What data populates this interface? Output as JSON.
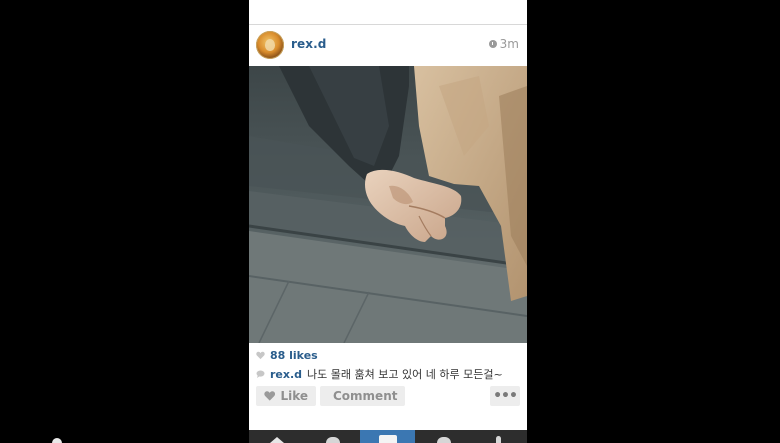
{
  "post": {
    "username": "rex.d",
    "time_ago": "3m",
    "likes": "88 likes",
    "caption_user": "rex.d",
    "caption_text": "나도 몰래 훔쳐 보고 있어 네 하루 모든걸~"
  },
  "actions": {
    "like_label": "Like",
    "comment_label": "Comment",
    "more_label": "•••"
  },
  "icons": {
    "clock": "clock-icon",
    "heart": "heart-icon",
    "comment": "comment-icon",
    "more": "more-icon"
  },
  "nav": {
    "items": [
      "home-icon",
      "explore-icon",
      "camera-icon",
      "news-icon",
      "profile-icon"
    ],
    "active_index": 2
  },
  "colors": {
    "link_blue": "#2a5d8c",
    "nav_bg": "#2d2d2d",
    "nav_active": "#3b77b2",
    "button_bg": "#ededed"
  }
}
